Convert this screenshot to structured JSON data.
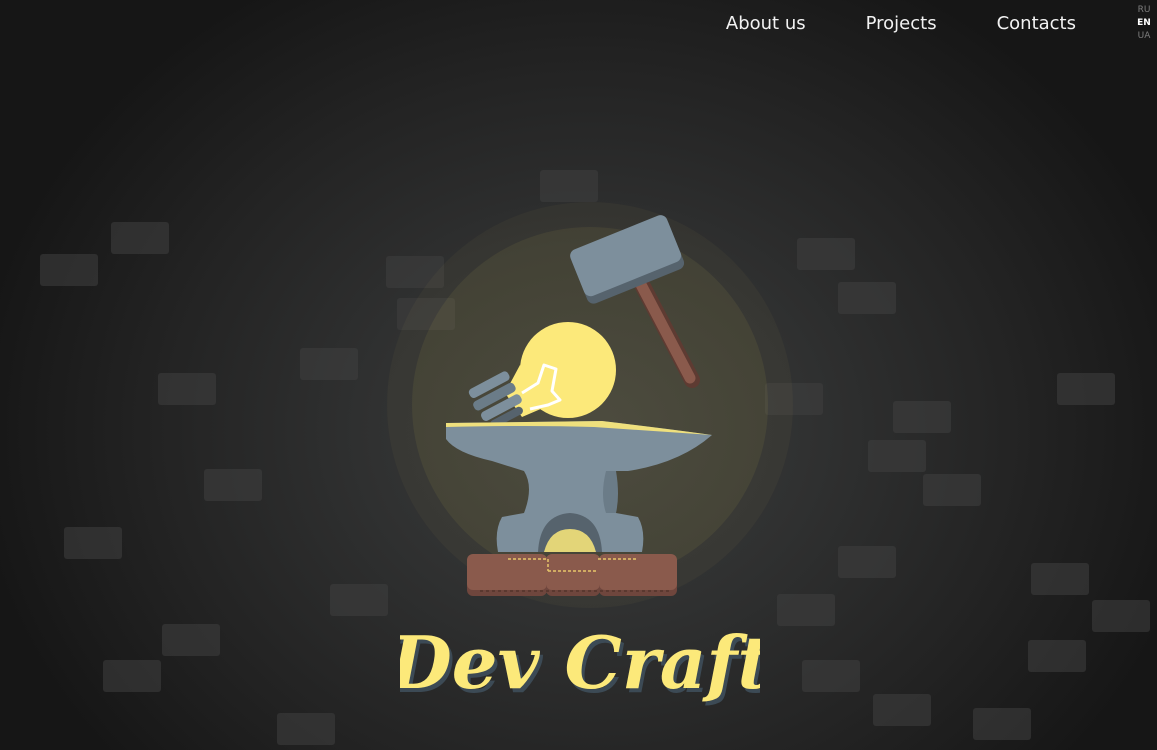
{
  "nav": {
    "items": [
      {
        "label": "About us"
      },
      {
        "label": "Projects"
      },
      {
        "label": "Contacts"
      }
    ]
  },
  "language": {
    "options": [
      "RU",
      "EN",
      "UA"
    ],
    "active": "EN"
  },
  "hero": {
    "title": "Dev Craft",
    "icons": [
      "hammer-icon",
      "lightbulb-icon",
      "anvil-icon"
    ]
  },
  "colors": {
    "background": "#2f3030",
    "brick": "#3f4040",
    "accent_yellow": "#fce97a",
    "steel": "#7d8f9c",
    "wood": "#8a5a4c",
    "nav_text": "#f2f2f2"
  }
}
